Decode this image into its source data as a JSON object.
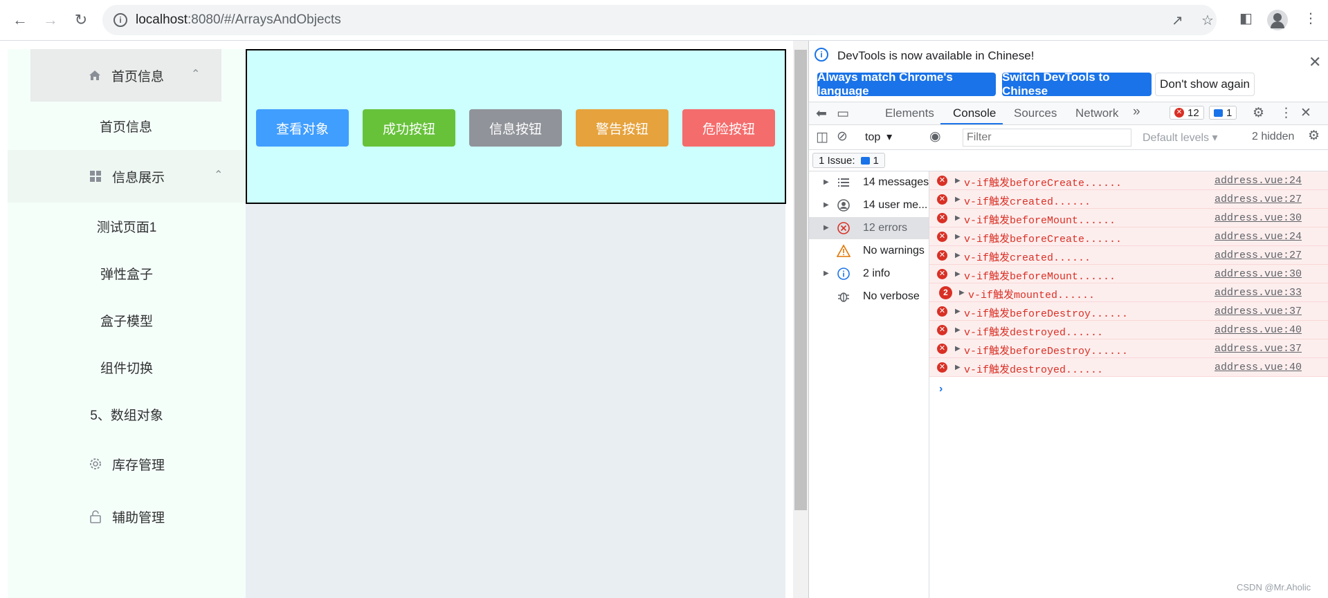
{
  "browser": {
    "url_host": "localhost",
    "url_rest": ":8080/#/ArraysAndObjects"
  },
  "sidebar": {
    "items": [
      {
        "label": "首页信息",
        "icon": "home-icon"
      },
      {
        "label": "首页信息"
      },
      {
        "label": "信息展示",
        "icon": "grid-icon"
      },
      {
        "label": "测试页面1"
      },
      {
        "label": "弹性盒子"
      },
      {
        "label": "盒子模型"
      },
      {
        "label": "组件切换"
      },
      {
        "label": "5、数组对象"
      },
      {
        "label": "库存管理",
        "icon": "gear-icon"
      },
      {
        "label": "辅助管理",
        "icon": "lock-icon"
      }
    ]
  },
  "buttons": [
    {
      "label": "查看对象",
      "color": "#409eff"
    },
    {
      "label": "成功按钮",
      "color": "#67c23a"
    },
    {
      "label": "信息按钮",
      "color": "#909399"
    },
    {
      "label": "警告按钮",
      "color": "#e6a23c"
    },
    {
      "label": "危险按钮",
      "color": "#f56c6c"
    }
  ],
  "devtools": {
    "notice": "DevTools is now available in Chinese!",
    "btn_match": "Always match Chrome's language",
    "btn_switch": "Switch DevTools to Chinese",
    "btn_dismiss": "Don't show again",
    "tabs": [
      "Elements",
      "Console",
      "Sources",
      "Network"
    ],
    "error_count": "12",
    "message_count": "1",
    "context": "top",
    "filter_placeholder": "Filter",
    "levels": "Default levels",
    "hidden": "2 hidden",
    "issue_label": "1 Issue:",
    "issue_count": "1",
    "sidebar": [
      {
        "label": "14 messages"
      },
      {
        "label": "14 user me..."
      },
      {
        "label": "12 errors"
      },
      {
        "label": "No warnings"
      },
      {
        "label": "2 info"
      },
      {
        "label": "No verbose"
      }
    ],
    "logs": [
      {
        "text": "v-if触发beforeCreate......",
        "src": "address.vue:24"
      },
      {
        "text": "v-if触发created......",
        "src": "address.vue:27"
      },
      {
        "text": "v-if触发beforeMount......",
        "src": "address.vue:30"
      },
      {
        "text": "v-if触发beforeCreate......",
        "src": "address.vue:24"
      },
      {
        "text": "v-if触发created......",
        "src": "address.vue:27"
      },
      {
        "text": "v-if触发beforeMount......",
        "src": "address.vue:30"
      },
      {
        "text": "v-if触发mounted......",
        "src": "address.vue:33",
        "count": "2"
      },
      {
        "text": "v-if触发beforeDestroy......",
        "src": "address.vue:37"
      },
      {
        "text": "v-if触发destroyed......",
        "src": "address.vue:40"
      },
      {
        "text": "v-if触发beforeDestroy......",
        "src": "address.vue:37"
      },
      {
        "text": "v-if触发destroyed......",
        "src": "address.vue:40"
      }
    ]
  },
  "watermark": "CSDN @Mr.Aholic"
}
